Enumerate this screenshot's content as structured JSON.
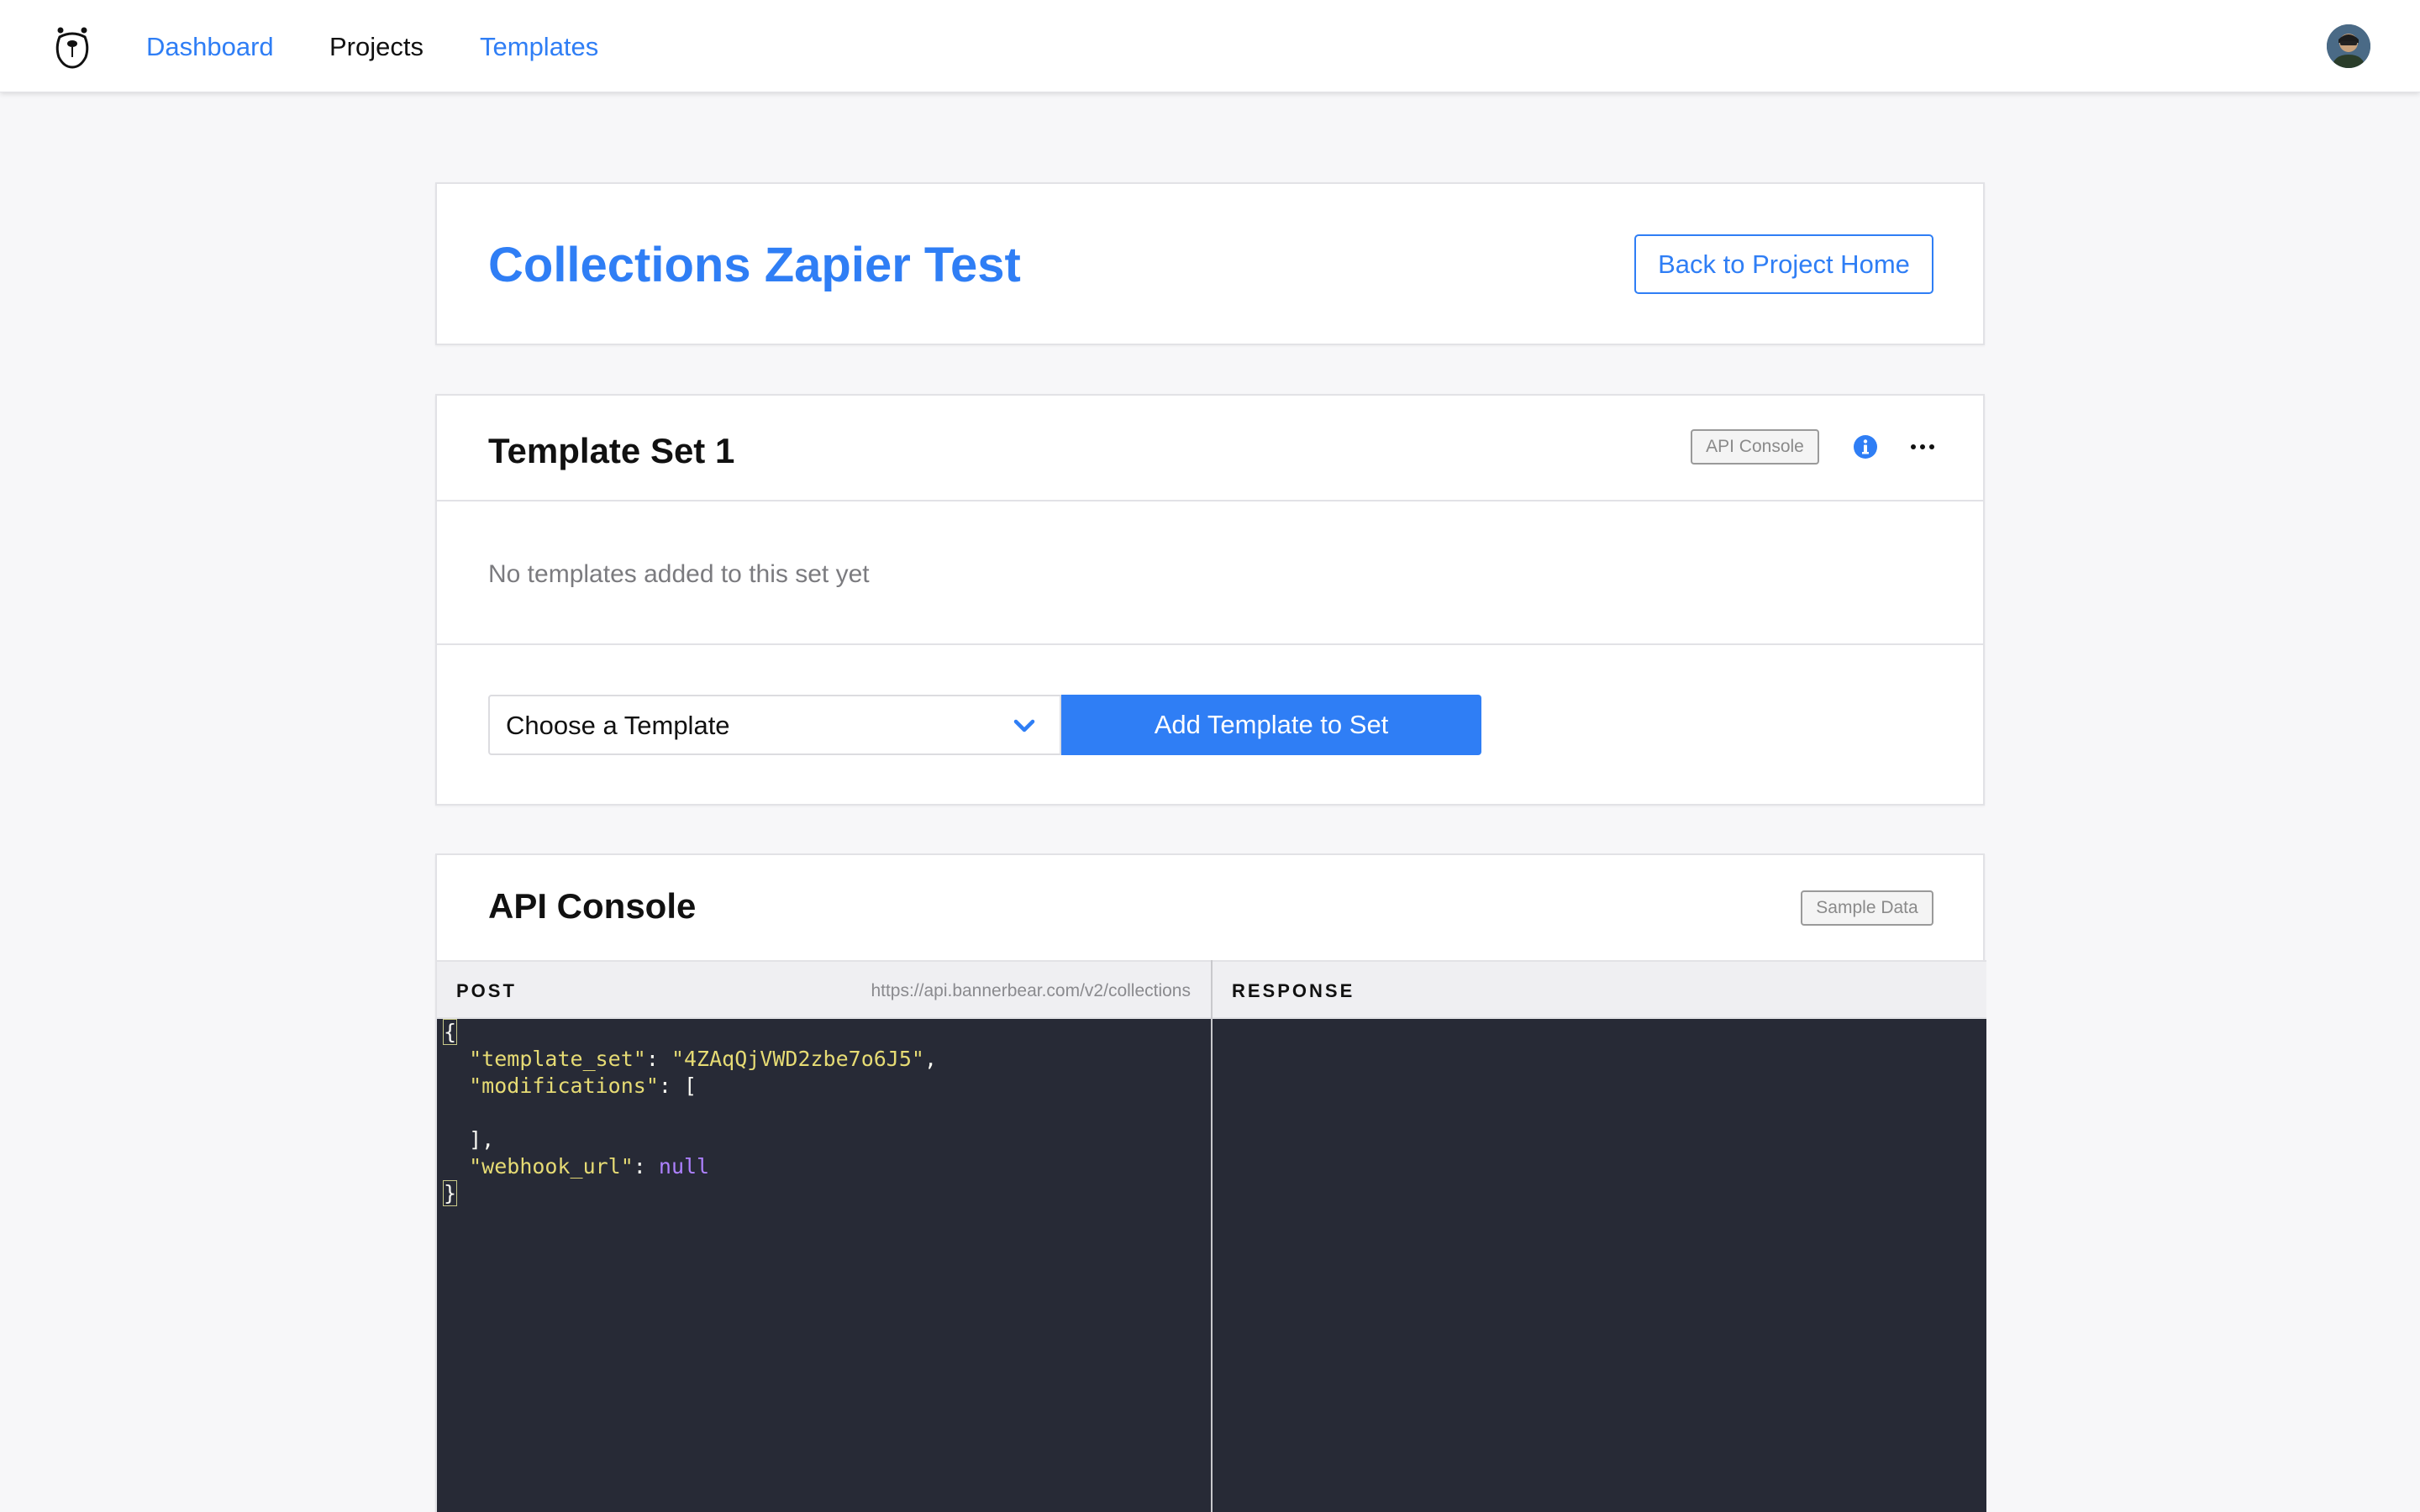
{
  "nav": {
    "links": [
      {
        "label": "Dashboard"
      },
      {
        "label": "Projects"
      },
      {
        "label": "Templates"
      }
    ]
  },
  "project": {
    "title": "Collections Zapier Test",
    "back_button": "Back to Project Home"
  },
  "template_set": {
    "title": "Template Set 1",
    "api_console_button": "API Console",
    "empty_message": "No templates added to this set yet",
    "select_placeholder": "Choose a Template",
    "add_button": "Add Template to Set"
  },
  "api_console": {
    "title": "API Console",
    "sample_data_button": "Sample Data",
    "request": {
      "method": "POST",
      "url": "https://api.bannerbear.com/v2/collections"
    },
    "response": {
      "label": "RESPONSE"
    },
    "code": {
      "open_brace": "{",
      "key_template_set": "\"template_set\"",
      "value_template_set": "\"4ZAqQjVWD2zbe7o6J5\"",
      "key_modifications": "\"modifications\"",
      "open_bracket": "[",
      "close_bracket": "],",
      "key_webhook_url": "\"webhook_url\"",
      "value_webhook_url": "null",
      "close_brace": "}"
    }
  },
  "colors": {
    "accent": "#2f7ef5",
    "editor_bg": "#272a36",
    "code_string": "#e6db74",
    "code_null": "#ae81ff"
  }
}
